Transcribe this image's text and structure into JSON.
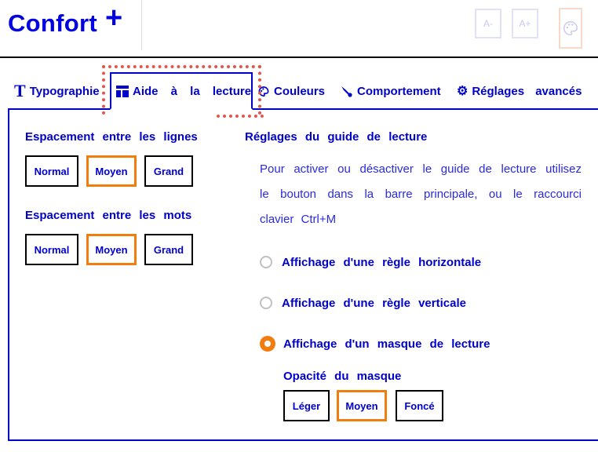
{
  "header": {
    "brand": "Confort",
    "brand_plus": "+",
    "zoom_out_label": "A-",
    "zoom_in_label": "A+"
  },
  "tabs": [
    {
      "label": "Typographie"
    },
    {
      "label": "Aide à la lecture"
    },
    {
      "label": "Couleurs"
    },
    {
      "label": "Comportement"
    },
    {
      "label": "Réglages avancés"
    }
  ],
  "line_spacing": {
    "title": "Espacement entre les lignes",
    "options": [
      "Normal",
      "Moyen",
      "Grand"
    ],
    "selected": "Moyen"
  },
  "word_spacing": {
    "title": "Espacement entre les mots",
    "options": [
      "Normal",
      "Moyen",
      "Grand"
    ],
    "selected": "Moyen"
  },
  "reading_guide": {
    "title": "Réglages du guide de lecture",
    "description": "Pour activer ou désactiver le guide de lecture utilisez le bouton dans la barre principale, ou le raccourci clavier Ctrl+M",
    "options": [
      {
        "label": "Affichage d'une règle horizontale",
        "checked": false
      },
      {
        "label": "Affichage d'une règle verticale",
        "checked": false
      },
      {
        "label": "Affichage d'un masque de lecture",
        "checked": true
      }
    ]
  },
  "mask_opacity": {
    "title": "Opacité du masque",
    "options": [
      "Léger",
      "Moyen",
      "Foncé"
    ],
    "selected": "Moyen"
  },
  "colors": {
    "accent": "#0000cc",
    "selected_border": "#f07d0d",
    "focus_ring": "#e2574c"
  }
}
